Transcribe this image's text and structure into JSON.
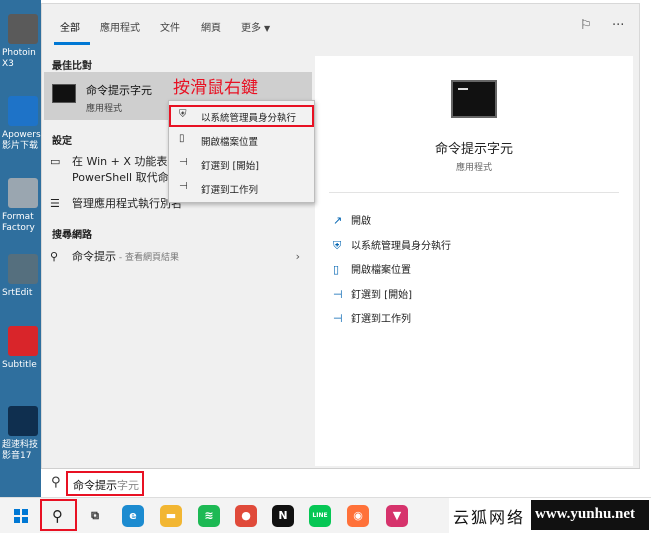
{
  "desktop": {
    "icons": [
      {
        "lines": [
          "Photoin",
          "X3"
        ],
        "icon": "photo-app-icon",
        "color": "#5a5a5a"
      },
      {
        "lines": [
          "Apowers",
          "影片下载"
        ],
        "icon": "apowersoft-icon",
        "color": "#1e73c8"
      },
      {
        "lines": [
          "Format",
          "Factory"
        ],
        "icon": "format-factory-icon",
        "color": "#9aa6b0"
      },
      {
        "lines": [
          "SrtEdit"
        ],
        "icon": "srtedit-icon",
        "color": "#556f7e"
      },
      {
        "lines": [
          "Subtitle"
        ],
        "icon": "subtitle-edit-icon",
        "color": "#d9252a"
      },
      {
        "lines": [
          "超速科技",
          "影音17"
        ],
        "icon": "video-app-icon",
        "color": "#0f2f4f"
      }
    ]
  },
  "tabs": {
    "items": [
      "全部",
      "應用程式",
      "文件",
      "網頁",
      "更多"
    ],
    "active": "全部",
    "feedback_icon": "feedback-icon",
    "more_icon": "ellipsis-icon"
  },
  "left": {
    "best_match_title": "最佳比對",
    "best_match": {
      "name": "命令提示字元",
      "type": "應用程式"
    },
    "settings_title": "設定",
    "settings": [
      {
        "line1": "在 Win + X 功能表中",
        "line2": "PowerShell 取代命令",
        "icon": "monitor-icon"
      },
      {
        "line1": "管理應用程式執行別名",
        "icon": "list-icon"
      }
    ],
    "web_title": "搜尋網路",
    "web_result": {
      "query": "命令提示",
      "sub": " - 查看網頁結果"
    }
  },
  "annotation": "按滑鼠右鍵",
  "context_menu": [
    {
      "label": "以系統管理員身分執行",
      "icon": "shield-icon",
      "highlighted": true
    },
    {
      "label": "開啟檔案位置",
      "icon": "folder-file-icon",
      "highlighted": false
    },
    {
      "label": "釘選到 [開始]",
      "icon": "pin-icon",
      "highlighted": false
    },
    {
      "label": "釘選到工作列",
      "icon": "pin-icon",
      "highlighted": false
    }
  ],
  "right": {
    "name": "命令提示字元",
    "type": "應用程式",
    "actions": [
      {
        "label": "開啟",
        "icon": "open-icon"
      },
      {
        "label": "以系統管理員身分執行",
        "icon": "shield-icon"
      },
      {
        "label": "開啟檔案位置",
        "icon": "folder-file-icon"
      },
      {
        "label": "釘選到 [開始]",
        "icon": "pin-icon"
      },
      {
        "label": "釘選到工作列",
        "icon": "pin-icon"
      }
    ]
  },
  "search": {
    "typed": "命令提示",
    "suggestion": "字元"
  },
  "taskbar": {
    "apps": [
      {
        "name": "task-view-icon",
        "color": "#f3f3f3",
        "glyph": "⧉"
      },
      {
        "name": "edge-icon",
        "color": "#1c8bd0",
        "glyph": "e"
      },
      {
        "name": "file-explorer-icon",
        "color": "#f2b632",
        "glyph": "▬"
      },
      {
        "name": "spotify-icon",
        "color": "#1db954",
        "glyph": "≋"
      },
      {
        "name": "chrome-icon",
        "color": "#e04a3a",
        "glyph": "●"
      },
      {
        "name": "netflix-icon",
        "color": "#111111",
        "glyph": "N"
      },
      {
        "name": "line-icon",
        "color": "#06c755",
        "glyph": "LINE"
      },
      {
        "name": "firefox-icon",
        "color": "#ff7139",
        "glyph": "◉"
      },
      {
        "name": "vpn-icon",
        "color": "#d6336c",
        "glyph": "▼"
      }
    ],
    "watermark_cn": "云狐网络",
    "watermark_url": "www.yunhu.net"
  }
}
